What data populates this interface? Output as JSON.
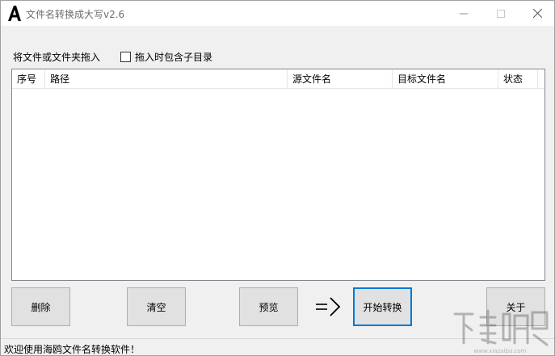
{
  "window": {
    "title": "文件名转换成大写v2.6",
    "app_icon": "letter-a-icon",
    "controls": [
      "minimize-icon",
      "maximize-icon",
      "close-icon"
    ]
  },
  "drop_area": {
    "label": "将文件或文件夹拖入",
    "include_subdirs": {
      "label": "拖入时包含子目录",
      "checked": false
    }
  },
  "table": {
    "columns": [
      "序号",
      "路径",
      "源文件名",
      "目标文件名",
      "状态"
    ],
    "rows": []
  },
  "buttons": {
    "delete": "删除",
    "clear": "清空",
    "preview": "预览",
    "start": "开始转换",
    "about": "关于"
  },
  "arrow_icon": "double-arrow-right-icon",
  "status": {
    "text": "欢迎使用海鸥文件名转换软件！"
  },
  "watermark": {
    "text": "下载吧",
    "url_text": "www.xiazaiba.com"
  }
}
